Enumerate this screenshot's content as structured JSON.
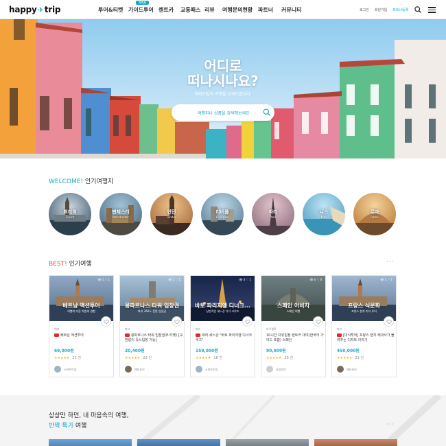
{
  "header": {
    "logo": {
      "left": "happy",
      "right": "trip"
    },
    "nav": [
      {
        "label": "투어&티켓"
      },
      {
        "label": "가이드투어",
        "badge": "가이드"
      },
      {
        "label": "렌트카"
      },
      {
        "label": "교통패스"
      },
      {
        "label": "리뷰"
      },
      {
        "label": "여행문의현황"
      },
      {
        "label": "파트너"
      },
      {
        "label": "커뮤니티"
      }
    ],
    "util": {
      "login": "로그인",
      "signup": "회원가입",
      "partner_register": "파트너등록"
    },
    "icons": [
      "search-icon",
      "menu-icon"
    ]
  },
  "hero": {
    "title_line1": "어디로",
    "title_line2": "떠나시나요?",
    "subtitle": "해피트립이 여행을 도와드립니다.",
    "search_placeholder": "여행지나 상품을 검색해보세요"
  },
  "welcome": {
    "accent": "WELCOME!",
    "title": "인기여행지",
    "destinations": [
      {
        "name": "취리히",
        "en": "Zurich"
      },
      {
        "name": "맨체스터",
        "en": "Manchester"
      },
      {
        "name": "런던",
        "en": "London"
      },
      {
        "name": "리버풀",
        "en": "Liverpool"
      },
      {
        "name": "파리",
        "en": "Paris"
      },
      {
        "name": "니스",
        "en": "Nice"
      },
      {
        "name": "로마",
        "en": "Rome"
      }
    ]
  },
  "best": {
    "accent": "BEST!",
    "title": "인기여행",
    "more": "···",
    "cards": [
      {
        "img_title": "베트남 액션투어",
        "img_sub": "여행의 다른 차원의 경험",
        "views": "1",
        "likes": "1",
        "seller": "해피",
        "title": "베트남 액션투어",
        "price": "69,000원",
        "stars": "★★★★★",
        "reviews": "22 건",
        "guide": "스마트트립"
      },
      {
        "img_title": "몽파르나스 타워 입장권",
        "img_sub": "파리 360도 전망 입장권",
        "views": "1",
        "likes": "1",
        "seller": "파리",
        "title": "몽파르나스 타워 입장권(E-티켓) [교환없이 즉시입장 가능]",
        "price": "20,400원",
        "stars": "★★★★★",
        "reviews": "23 건",
        "guide": "해피유선"
      },
      {
        "img_title": "바토 파리지앵 디너크...",
        "img_sub": "낭만적인 세느강 디너 크루즈",
        "views": "3",
        "likes": "1",
        "seller": "파리",
        "title": "파리 세느강 \"바토 파리지앵 디너크루즈\"",
        "price": "159,000원",
        "stars": "★★★★★",
        "reviews": "18 건",
        "guide": "스마트트립"
      },
      {
        "img_title": "스페인 어비지",
        "img_sub": "스페인 여행",
        "views": "0",
        "likes": "0",
        "seller": "바르셀로",
        "title": "10시간 자유일정 렌트카 대여(한국어 가이드 포함) 스페인",
        "price": "90,000원",
        "stars": "★★★★★",
        "reviews": "23 건",
        "guide": "유럽투어"
      },
      {
        "img_title": "프랑스 식문화",
        "img_sub": "프랑스 현지 미식 투어",
        "views": "1",
        "likes": "1",
        "seller": "파리",
        "title": "[미식투어] 프랑스 현지 레과사가 들려주는 디저트 이야기",
        "price": "450,000원",
        "stars": "★★★★★",
        "reviews": "23 건",
        "guide": "해피유선"
      }
    ]
  },
  "bottom": {
    "line1": "상상만 하던, 내 마음속의 여행,",
    "accent": "반짝 특가",
    "line2_rest": "여행",
    "more": "···"
  },
  "colors": {
    "accent": "#17a9c4",
    "best": "#ef4b3f",
    "star": "#f5b400",
    "youtube": "#e02b27"
  }
}
